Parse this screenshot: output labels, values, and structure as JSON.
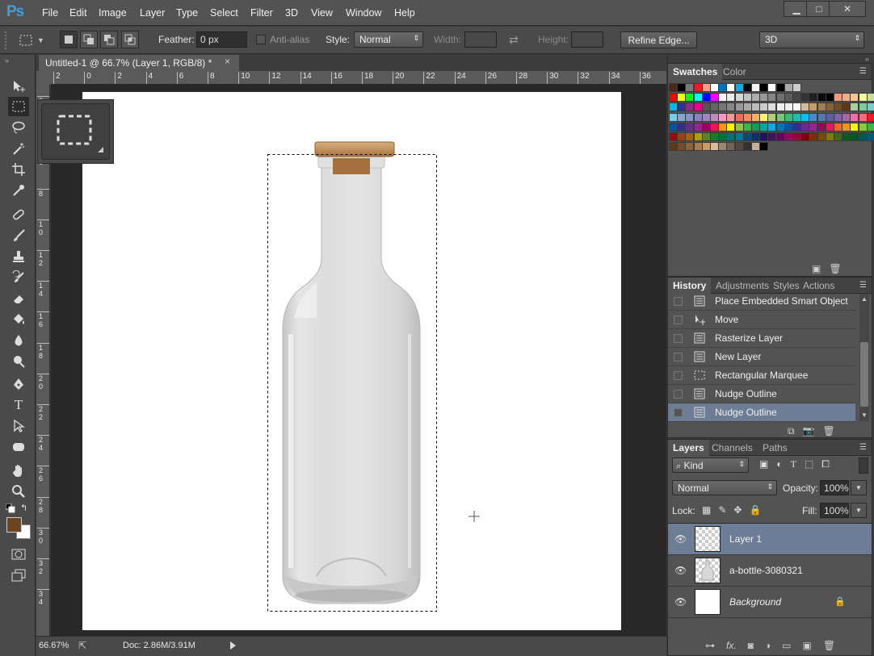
{
  "app": {
    "logo": "Ps"
  },
  "menu": [
    "File",
    "Edit",
    "Image",
    "Layer",
    "Type",
    "Select",
    "Filter",
    "3D",
    "View",
    "Window",
    "Help"
  ],
  "window_controls": {
    "minimize": "▁",
    "maximize": "□",
    "close": "✕"
  },
  "options": {
    "feather_label": "Feather:",
    "feather_value": "0 px",
    "antialias_label": "Anti-alias",
    "style_label": "Style:",
    "style_value": "Normal",
    "width_label": "Width:",
    "height_label": "Height:",
    "refine_edge": "Refine Edge...",
    "workspace": "3D"
  },
  "document": {
    "tab_title": "Untitled-1 @ 66.7% (Layer 1, RGB/8) *",
    "close": "×",
    "h_ticks": [
      "2",
      "0",
      "2",
      "4",
      "6",
      "8",
      "10",
      "12",
      "14",
      "16",
      "18",
      "20",
      "22",
      "24",
      "26",
      "28",
      "30",
      "32",
      "34",
      "36"
    ],
    "v_ticks": [
      "2",
      "4",
      "6",
      "8",
      "1\n0",
      "1\n2",
      "1\n4",
      "1\n6",
      "1\n8",
      "2\n0",
      "2\n2",
      "2\n4",
      "2\n6",
      "2\n8",
      "3\n0",
      "3\n2",
      "3\n4"
    ]
  },
  "status": {
    "zoom": "66.67%",
    "doc": "Doc: 2.86M/3.91M"
  },
  "swatches_panel": {
    "tabs": [
      "Swatches",
      "Color"
    ],
    "rows": [
      [
        "#4a2a14",
        "#000000",
        "#7a7a7a",
        "#ed1c24",
        "#f5a08a",
        "#ffffff",
        "#0072bc",
        "#ffffff",
        "#00aeef",
        "#000000",
        "#f2f2f2",
        "#000000",
        "#ffffff",
        "#000000",
        "#aaaaaa",
        "#cccccc"
      ],
      [
        "#ff0000",
        "#ffff00",
        "#00ff00",
        "#00ffff",
        "#0000ff",
        "#ff00ff",
        "#ffffff",
        "#ebebeb",
        "#d6d6d6",
        "#c2c2c2",
        "#adadad",
        "#999999",
        "#858585",
        "#707070",
        "#5c5c5c",
        "#474747",
        "#333333",
        "#1f1f1f",
        "#0a0a0a",
        "#000000",
        "#f7977a",
        "#f9ad81",
        "#fdc68a",
        "#fff79a",
        "#c4df9b"
      ],
      [
        "#00b7ef",
        "#2e3192",
        "#92278f",
        "#ec008c",
        "#555555",
        "#666666",
        "#777777",
        "#888888",
        "#999999",
        "#aaaaaa",
        "#bbbbbb",
        "#cccccc",
        "#dddddd",
        "#eeeeee",
        "#f0f0f0",
        "#f7f7f7",
        "#d3bca1",
        "#c69c6d",
        "#a67c52",
        "#8c6239",
        "#754c24",
        "#603913",
        "#a3d39c",
        "#82ca9d",
        "#7accc8"
      ],
      [
        "#6dcff6",
        "#7da7d9",
        "#8393ca",
        "#8781bd",
        "#a186be",
        "#bd8cbf",
        "#f49ac1",
        "#f5989d",
        "#f26c4f",
        "#f68e56",
        "#fbaf5d",
        "#fff568",
        "#acd373",
        "#7cc576",
        "#3cb878",
        "#1cbbb4",
        "#00bff3",
        "#448ccb",
        "#5674b9",
        "#605ca8",
        "#855fa8",
        "#a864a8",
        "#f06eaa",
        "#f26d7d",
        "#ed1c24"
      ],
      [
        "#0054a6",
        "#2e3192",
        "#662d91",
        "#92278f",
        "#9e005d",
        "#ed145b",
        "#f7941d",
        "#fff200",
        "#8dc63f",
        "#39b54a",
        "#00a651",
        "#00a99d",
        "#00aeef",
        "#0072bc",
        "#0054a6",
        "#2e3192",
        "#662d91",
        "#92278f",
        "#9e005d",
        "#ed145b",
        "#f26522",
        "#f7941d",
        "#fff200",
        "#8dc63f",
        "#39b54a"
      ],
      [
        "#9e0b0f",
        "#a0410d",
        "#a36209",
        "#aba000",
        "#598527",
        "#1a7b30",
        "#007236",
        "#00746b",
        "#0076a3",
        "#004a80",
        "#003471",
        "#1b1464",
        "#440e62",
        "#630460",
        "#9e005d",
        "#9e0039",
        "#790000",
        "#7b2e00",
        "#7d4900",
        "#827b00",
        "#406618",
        "#005e20",
        "#005826",
        "#005952",
        "#005b7f"
      ],
      [
        "#603813",
        "#754c24",
        "#8c6239",
        "#a67c52",
        "#c69c6d",
        "#d3bca1",
        "#998675",
        "#736357",
        "#534741",
        "#362f2d",
        "#c7b299",
        "#000000"
      ]
    ]
  },
  "history_panel": {
    "tabs": [
      "History",
      "Adjustments",
      "Styles",
      "Actions"
    ],
    "items": [
      {
        "label": "Place Embedded Smart Object",
        "icon": "doc-icon",
        "active": false
      },
      {
        "label": "Move",
        "icon": "move-icon",
        "active": false
      },
      {
        "label": "Rasterize Layer",
        "icon": "doc-icon",
        "active": false
      },
      {
        "label": "New Layer",
        "icon": "doc-icon",
        "active": false
      },
      {
        "label": "Rectangular Marquee",
        "icon": "marquee-icon",
        "active": false
      },
      {
        "label": "Nudge Outline",
        "icon": "doc-icon",
        "active": false
      },
      {
        "label": "Nudge Outline",
        "icon": "doc-icon",
        "active": true
      }
    ]
  },
  "layers_panel": {
    "tabs": [
      "Layers",
      "Channels",
      "Paths"
    ],
    "kind": "Kind",
    "blend_mode": "Normal",
    "opacity_label": "Opacity:",
    "opacity_value": "100%",
    "lock_label": "Lock:",
    "fill_label": "Fill:",
    "fill_value": "100%",
    "layers": [
      {
        "name": "Layer 1",
        "active": true,
        "italic": false,
        "thumb": "transparent"
      },
      {
        "name": "a-bottle-3080321",
        "active": false,
        "italic": false,
        "thumb": "bottle"
      },
      {
        "name": "Background",
        "active": false,
        "italic": true,
        "thumb": "white",
        "locked": true
      }
    ]
  },
  "colors": {
    "foreground": "#6b4420",
    "background": "#ffffff",
    "accent_selected": "#6d7d95"
  }
}
